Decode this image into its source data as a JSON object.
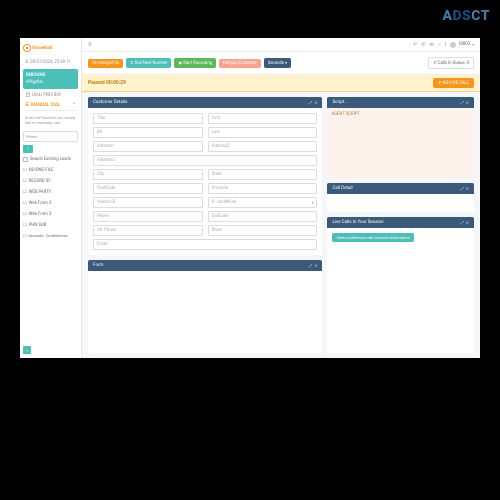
{
  "watermark": "ADSCT",
  "logo": {
    "text": "VoiceBald"
  },
  "sidebar": {
    "date": "05/07/2024, 23:38:11",
    "inbound_label": "INBOUND",
    "inbound_sub": "APIgyfds",
    "preview": "DIALI PREVIEW",
    "manual_header": "MANUAL DIAL",
    "manual_note": "Enter the Number you would like to manually call:",
    "phone_placeholder": "Phone",
    "search_leads": "Search Existing Leads",
    "no_dnc": "NO-DNC-FILE",
    "record_id": "RECORD ID:",
    "web_party": "WEB PARTY:",
    "web_form2": "Web Form 2:",
    "web_form3": "Web Form 3:",
    "phn_sub": "PHN SUB",
    "seconds": "Seconds:",
    "conferences": "Conferences:"
  },
  "topbar": {
    "user": "10003",
    "icons": [
      "back",
      "phone",
      "msg",
      "bell",
      "minus"
    ]
  },
  "actions": {
    "hangup": "I'm Hanged Up",
    "dial_next": "Dial Next Number",
    "recording": "Start Recording",
    "customer": "Hangup Customer",
    "seconds": "Seconds",
    "calls_in_queue": "Calls In Queue: 0"
  },
  "pause_bar": {
    "status": "Paused 00:00:29",
    "no_live": "NO LIVE CALL"
  },
  "customer_details": {
    "title": "Customer Details",
    "fields": {
      "title_f": "Title",
      "first": "First",
      "mi": "MI",
      "last": "Last",
      "addr1": "Address1",
      "addr2": "Address2",
      "addr3": "Address3",
      "city": "City",
      "state": "State",
      "post": "PostCode",
      "province": "Province",
      "vendor": "Vendor ID",
      "undefined": "0 - Undefined",
      "phone": "Phone",
      "dial_code": "DialCode",
      "alt_phone": "Alt. Phone",
      "show": "Show",
      "email": "Email"
    }
  },
  "form_card": {
    "title": "Form"
  },
  "script_card": {
    "title": "Script...",
    "body": "AGENT SCRIPT"
  },
  "call_detail": {
    "title": "Call Detail"
  },
  "live_calls": {
    "title": "Live Calls In Your Session",
    "pill": "View conference call channel information"
  }
}
